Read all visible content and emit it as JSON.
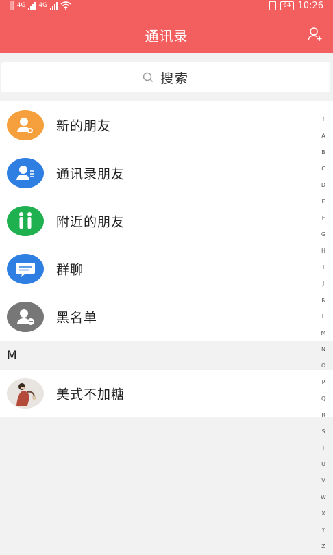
{
  "status_bar": {
    "net1": "4G",
    "net2": "4G",
    "battery": "64",
    "time": "10:26"
  },
  "header": {
    "title": "通讯录",
    "add_icon": "add-user-icon"
  },
  "search": {
    "label": "搜索",
    "icon": "search-icon"
  },
  "menu": [
    {
      "label": "新的朋友",
      "icon": "new-friend-icon",
      "color": "#f5a03c"
    },
    {
      "label": "通讯录朋友",
      "icon": "contacts-friend-icon",
      "color": "#2f7fe3"
    },
    {
      "label": "附近的朋友",
      "icon": "nearby-friend-icon",
      "color": "#1fb14f"
    },
    {
      "label": "群聊",
      "icon": "group-chat-icon",
      "color": "#2f7fe3"
    },
    {
      "label": "黑名单",
      "icon": "blacklist-icon",
      "color": "#777777"
    }
  ],
  "section": {
    "letter": "M"
  },
  "contacts": [
    {
      "name": "美式不加糖",
      "avatar": "user-avatar"
    }
  ],
  "index_letters": [
    "↑",
    "A",
    "B",
    "C",
    "D",
    "E",
    "F",
    "G",
    "H",
    "I",
    "J",
    "K",
    "L",
    "M",
    "N",
    "O",
    "P",
    "Q",
    "R",
    "S",
    "T",
    "U",
    "V",
    "W",
    "X",
    "Y",
    "Z"
  ],
  "colors": {
    "accent": "#f35e5e",
    "background": "#f2f2f2"
  }
}
